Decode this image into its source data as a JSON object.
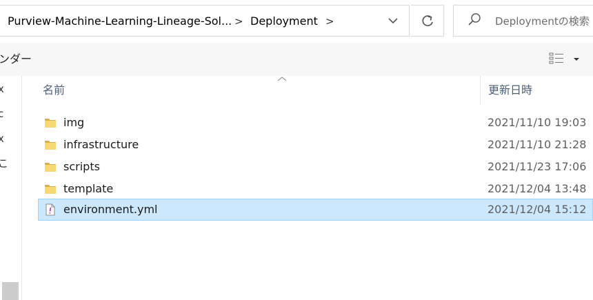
{
  "address_bar": {
    "breadcrumbs": [
      "Purview-Machine-Learning-Lineage-Sol...",
      "Deployment"
    ],
    "separator": ">",
    "dropdown_icon": "chevron-down-icon",
    "refresh_icon": "refresh-icon"
  },
  "search": {
    "placeholder": "Deploymentの検索",
    "icon": "search-icon"
  },
  "command_bar": {
    "left_text": "ンダー",
    "view_icon": "details-view-icon",
    "view_dropdown_icon": "caret-down-icon"
  },
  "nav_pane": {
    "glyphs": [
      "x",
      "c",
      "x",
      "こ"
    ]
  },
  "file_list": {
    "columns": {
      "name": "名前",
      "date_modified": "更新日時"
    },
    "sort_indicator": "caret-up-icon",
    "rows": [
      {
        "name": "img",
        "date": "2021/11/10 19:03",
        "type": "folder",
        "selected": false
      },
      {
        "name": "infrastructure",
        "date": "2021/11/10 21:28",
        "type": "folder",
        "selected": false
      },
      {
        "name": "scripts",
        "date": "2021/11/23 17:06",
        "type": "folder",
        "selected": false
      },
      {
        "name": "template",
        "date": "2021/12/04 13:48",
        "type": "folder",
        "selected": false
      },
      {
        "name": "environment.yml",
        "date": "2021/12/04 15:12",
        "type": "yml-file",
        "selected": true
      }
    ]
  },
  "colors": {
    "selection_fill": "#cce8ff",
    "selection_border": "#99d1ff",
    "folder_yellow": "#f8d775",
    "header_text": "#4c607a"
  }
}
